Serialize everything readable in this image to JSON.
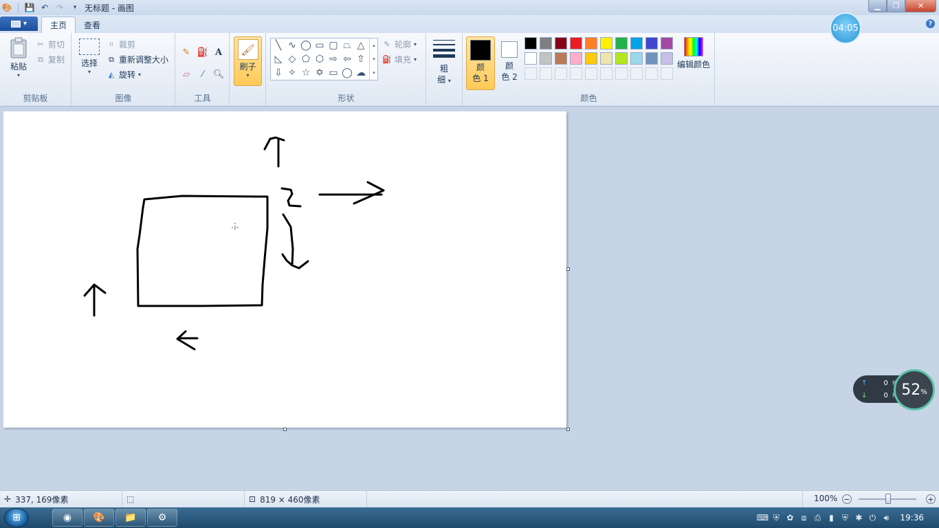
{
  "app": {
    "title": "无标题 - 画图"
  },
  "tabs": [
    {
      "label": "主页",
      "active": true
    },
    {
      "label": "查看",
      "active": false
    }
  ],
  "ribbon": {
    "clipboard": {
      "paste": "粘贴",
      "cut": "剪切",
      "copy": "复制",
      "group": "剪贴板"
    },
    "image": {
      "select": "选择",
      "crop": "裁剪",
      "resize": "重新调整大小",
      "rotate": "旋转",
      "group": "图像"
    },
    "tools": {
      "group": "工具"
    },
    "brushes": {
      "label": "刷子"
    },
    "shapes": {
      "outline": "轮廓",
      "fill": "填充",
      "group": "形状"
    },
    "size": {
      "label_1": "粗",
      "label_2": "细"
    },
    "colors": {
      "color1_a": "颜",
      "color1_b": "色 1",
      "color2_a": "颜",
      "color2_b": "色 2",
      "edit": "编辑颜色",
      "group": "颜色",
      "color1_value": "#000000",
      "color2_value": "#ffffff",
      "palette": [
        "#000000",
        "#7f7f7f",
        "#880015",
        "#ed1c24",
        "#ff7f27",
        "#fff200",
        "#22b14c",
        "#00a2e8",
        "#3f48cc",
        "#a349a4",
        "#ffffff",
        "#c3c3c3",
        "#b97a57",
        "#ffaec9",
        "#ffc90e",
        "#efe4b0",
        "#b5e61d",
        "#99d9ea",
        "#7092be",
        "#c8bfe7"
      ]
    }
  },
  "status": {
    "cursor_pos": "337, 169像素",
    "canvas_size": "819 × 460像素",
    "zoom": "100%"
  },
  "widgets": {
    "timer": "04:05",
    "upload": "0",
    "download": "0",
    "speed_unit": "K/s",
    "usage": "52",
    "usage_unit": "%"
  },
  "taskbar": {
    "clock": "19:36"
  }
}
